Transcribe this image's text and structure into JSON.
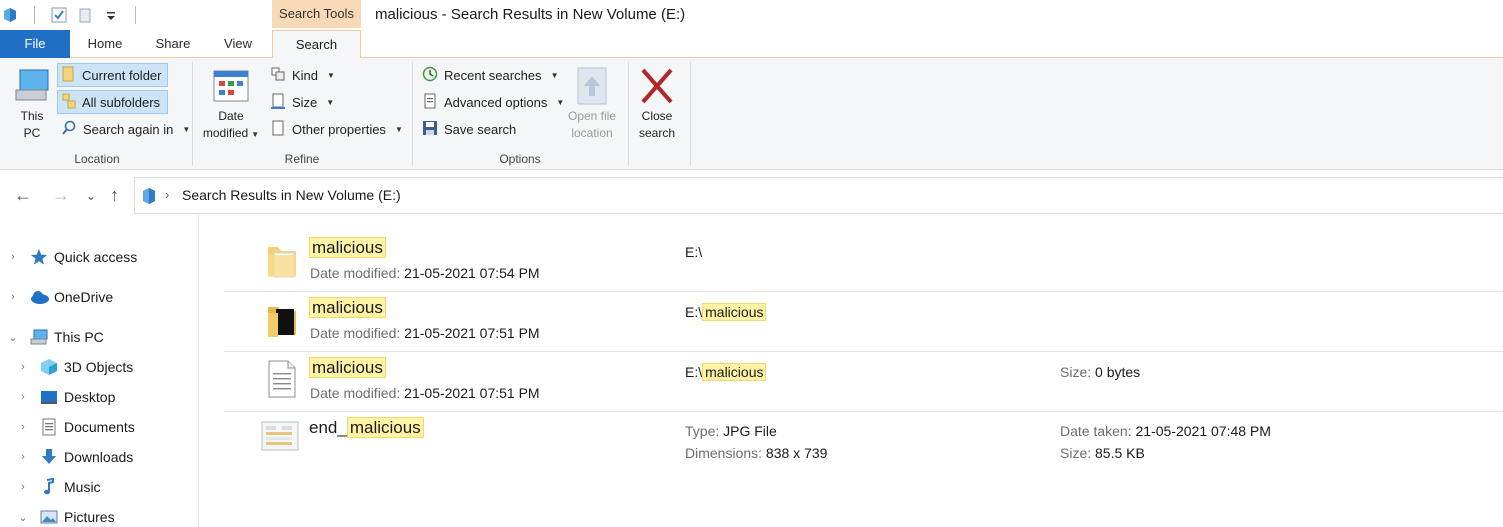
{
  "window": {
    "contextual_tab": "Search Tools",
    "title": "malicious - Search Results in New Volume (E:)"
  },
  "tabs": [
    "File",
    "Home",
    "Share",
    "View",
    "Search"
  ],
  "ribbon": {
    "location": {
      "label": "Location",
      "this_pc_line1": "This",
      "this_pc_line2": "PC",
      "current_folder": "Current folder",
      "all_subfolders": "All subfolders",
      "search_again": "Search again in"
    },
    "refine": {
      "label": "Refine",
      "date_modified_line1": "Date",
      "date_modified_line2": "modified",
      "kind": "Kind",
      "size": "Size",
      "other_properties": "Other properties"
    },
    "options": {
      "label": "Options",
      "recent_searches": "Recent searches",
      "advanced_options": "Advanced options",
      "save_search": "Save search",
      "open_file_location_line1": "Open file",
      "open_file_location_line2": "location"
    },
    "close": {
      "line1": "Close",
      "line2": "search"
    }
  },
  "address": {
    "path": "Search Results in New Volume (E:)"
  },
  "navpane": {
    "quick_access": "Quick access",
    "onedrive": "OneDrive",
    "this_pc": "This PC",
    "objects_3d": "3D Objects",
    "desktop": "Desktop",
    "documents": "Documents",
    "downloads": "Downloads",
    "music": "Music",
    "pictures": "Pictures"
  },
  "results": [
    {
      "name_prefix": "",
      "name_hl": "malicious",
      "date_label": "Date modified:",
      "date_value": "21-05-2021 07:54 PM",
      "path_prefix": "E:\\",
      "path_hl": "",
      "icon": "folder-icon"
    },
    {
      "name_prefix": "",
      "name_hl": "malicious",
      "date_label": "Date modified:",
      "date_value": "21-05-2021 07:51 PM",
      "path_prefix": "E:\\",
      "path_hl": "malicious",
      "icon": "folder-dark-icon"
    },
    {
      "name_prefix": "",
      "name_hl": "malicious",
      "date_label": "Date modified:",
      "date_value": "21-05-2021 07:51 PM",
      "path_prefix": "E:\\",
      "path_hl": "malicious",
      "size_label": "Size:",
      "size_value": "0 bytes",
      "icon": "text-file-icon"
    },
    {
      "name_prefix": "end_",
      "name_hl": "malicious",
      "type_label": "Type:",
      "type_value": "JPG File",
      "dim_label": "Dimensions:",
      "dim_value": "838 x 739",
      "taken_label": "Date taken:",
      "taken_value": "21-05-2021 07:48 PM",
      "size_label": "Size:",
      "size_value": "85.5 KB",
      "icon": "image-file-icon"
    }
  ]
}
